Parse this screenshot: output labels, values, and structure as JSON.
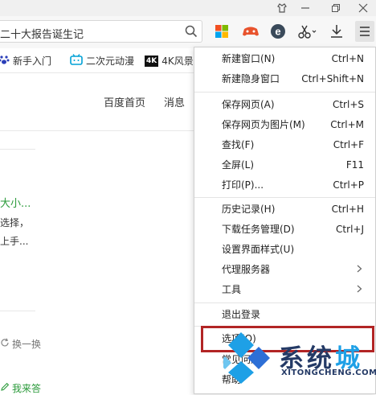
{
  "toolbar": {
    "address_text": "二十大报告诞生记",
    "icons": [
      "search-icon",
      "apps-icon",
      "game-icon",
      "ie-icon",
      "scissors-icon",
      "download-icon",
      "menu-icon"
    ]
  },
  "bookmarks": [
    {
      "label": "新手入门",
      "icon": "paw-icon"
    },
    {
      "label": "二次元动漫",
      "icon": "bilibili-icon"
    },
    {
      "label": "4K风景",
      "icon": "4k-icon",
      "badge": "4K"
    }
  ],
  "page": {
    "nav": [
      "百度首页",
      "消息"
    ],
    "snippet_title": "大小...",
    "snippet_lines": [
      "选择，",
      "上手..."
    ],
    "refresh_label": "换一换",
    "bottom_link": "我来答"
  },
  "menu": {
    "groups": [
      [
        {
          "label": "新建窗口(N)",
          "shortcut": "Ctrl+N"
        },
        {
          "label": "新建隐身窗口",
          "shortcut": "Ctrl+Shift+N"
        }
      ],
      [
        {
          "label": "保存网页(A)",
          "shortcut": "Ctrl+S"
        },
        {
          "label": "保存网页为图片(M)",
          "shortcut": "Ctrl+M"
        },
        {
          "label": "查找(F)",
          "shortcut": "Ctrl+F"
        },
        {
          "label": "全屏(L)",
          "shortcut": "F11"
        },
        {
          "label": "打印(P)...",
          "shortcut": "Ctrl+P"
        }
      ],
      [
        {
          "label": "历史记录(H)",
          "shortcut": "Ctrl+H"
        },
        {
          "label": "下载任务管理(D)",
          "shortcut": "Ctrl+J"
        },
        {
          "label": "设置界面样式(U)",
          "shortcut": ""
        },
        {
          "label": "代理服务器",
          "shortcut": "",
          "submenu": true
        },
        {
          "label": "工具",
          "shortcut": "",
          "submenu": true
        }
      ],
      [
        {
          "label": "退出登录",
          "shortcut": ""
        }
      ],
      [
        {
          "label": "选项(O)",
          "shortcut": ""
        },
        {
          "label": "常见问题",
          "shortcut": ""
        },
        {
          "label": "帮助",
          "shortcut": ""
        }
      ]
    ]
  },
  "watermark": {
    "text_main": "系统",
    "text_accent": "城",
    "domain": "XITONGCHENG.COM"
  },
  "colors": {
    "highlight_border": "#b22525",
    "watermark_dark": "#243a66",
    "watermark_blue": "#1ea0e6",
    "link_green": "#2a9a3a"
  }
}
